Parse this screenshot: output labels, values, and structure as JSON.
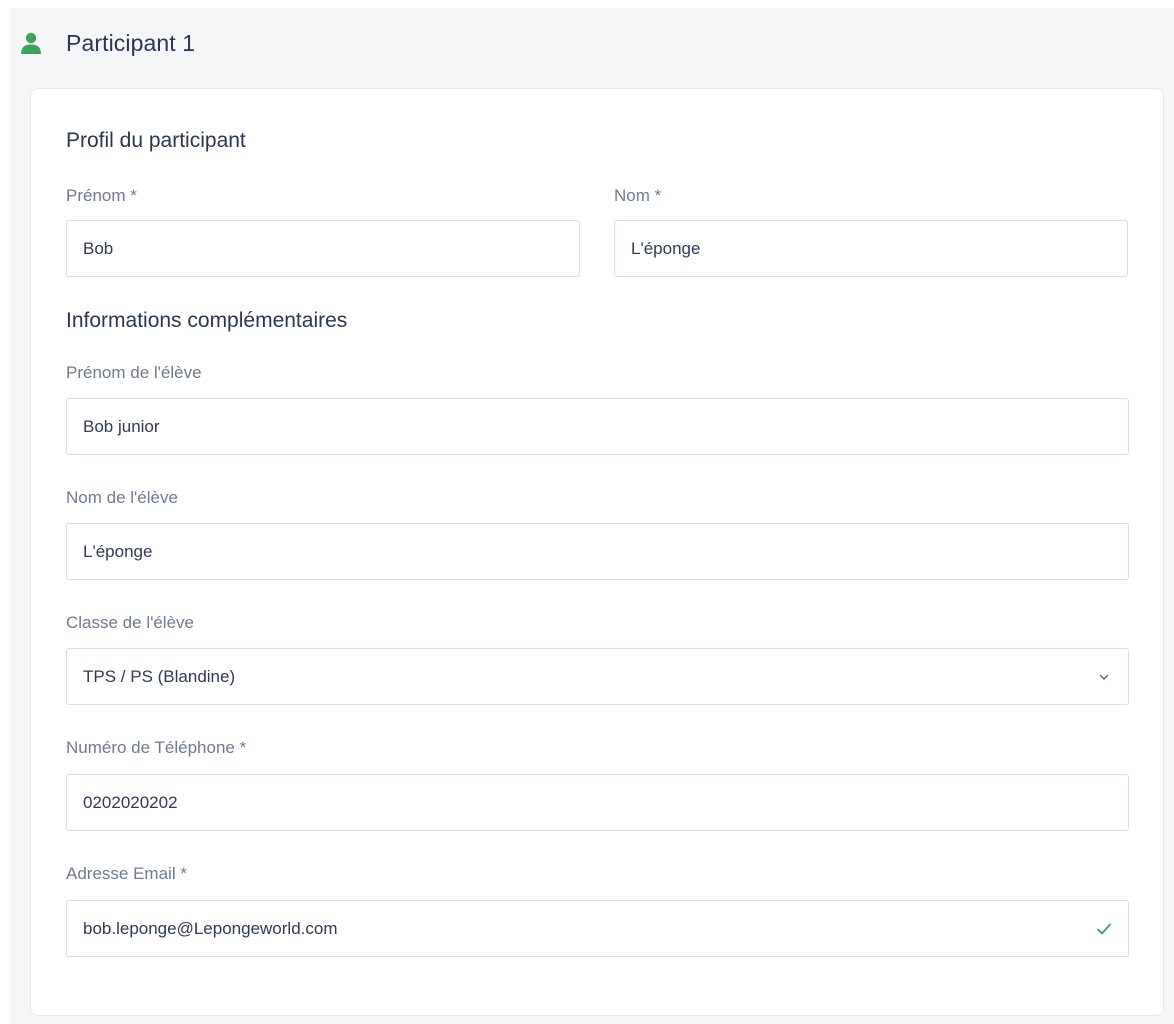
{
  "header": {
    "title": "Participant 1",
    "icon": "user-icon",
    "icon_color": "#3aa55d"
  },
  "profile": {
    "section_title": "Profil du participant",
    "first_name": {
      "label": "Prénom *",
      "value": "Bob"
    },
    "last_name": {
      "label": "Nom *",
      "value": "L'éponge"
    }
  },
  "extra": {
    "section_title": "Informations complémentaires",
    "student_first_name": {
      "label": "Prénom de l'élève",
      "value": "Bob junior"
    },
    "student_last_name": {
      "label": "Nom de l'élève",
      "value": "L'éponge"
    },
    "student_class": {
      "label": "Classe de l'élève",
      "value": "TPS / PS (Blandine)",
      "icon": "chevron-down-icon"
    },
    "phone": {
      "label": "Numéro de Téléphone *",
      "value": "0202020202"
    },
    "email": {
      "label": "Adresse Email *",
      "value": "bob.leponge@Lepongeworld.com",
      "icon": "checkmark-icon",
      "valid_color": "#3aa55d"
    }
  }
}
